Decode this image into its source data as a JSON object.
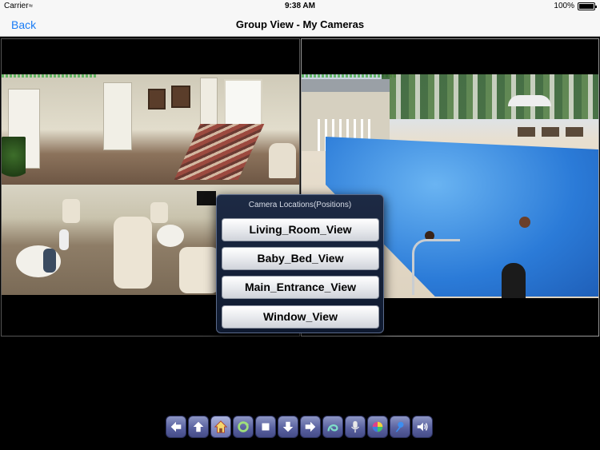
{
  "status_bar": {
    "carrier": "Carrier",
    "wifi_icon": "wifi-icon",
    "time": "9:38 AM",
    "battery_percent": "100%",
    "battery_icon": "battery-icon"
  },
  "nav": {
    "back_label": "Back",
    "title": "Group View - My Cameras"
  },
  "cameras": [
    {
      "name": "hallway-lounge-camera",
      "selected": false
    },
    {
      "name": "pool-camera",
      "selected": true
    }
  ],
  "popup": {
    "title": "Camera Locations(Positions)",
    "options": [
      "Living_Room_View",
      "Baby_Bed_View",
      "Main_Entrance_View",
      "Window_View"
    ]
  },
  "toolbar": {
    "buttons": [
      {
        "icon": "arrow-left-icon"
      },
      {
        "icon": "arrow-up-icon"
      },
      {
        "icon": "home-icon"
      },
      {
        "icon": "rotate-icon"
      },
      {
        "icon": "stop-icon"
      },
      {
        "icon": "arrow-down-icon"
      },
      {
        "icon": "arrow-right-icon"
      },
      {
        "icon": "patrol-icon"
      },
      {
        "icon": "microphone-icon"
      },
      {
        "icon": "color-wheel-icon"
      },
      {
        "icon": "pin-icon"
      },
      {
        "icon": "speaker-icon"
      }
    ]
  },
  "colors": {
    "accent": "#1a7cf5",
    "toolbar_button": "#5a62a0",
    "popup_bg": "#1d2a44"
  }
}
